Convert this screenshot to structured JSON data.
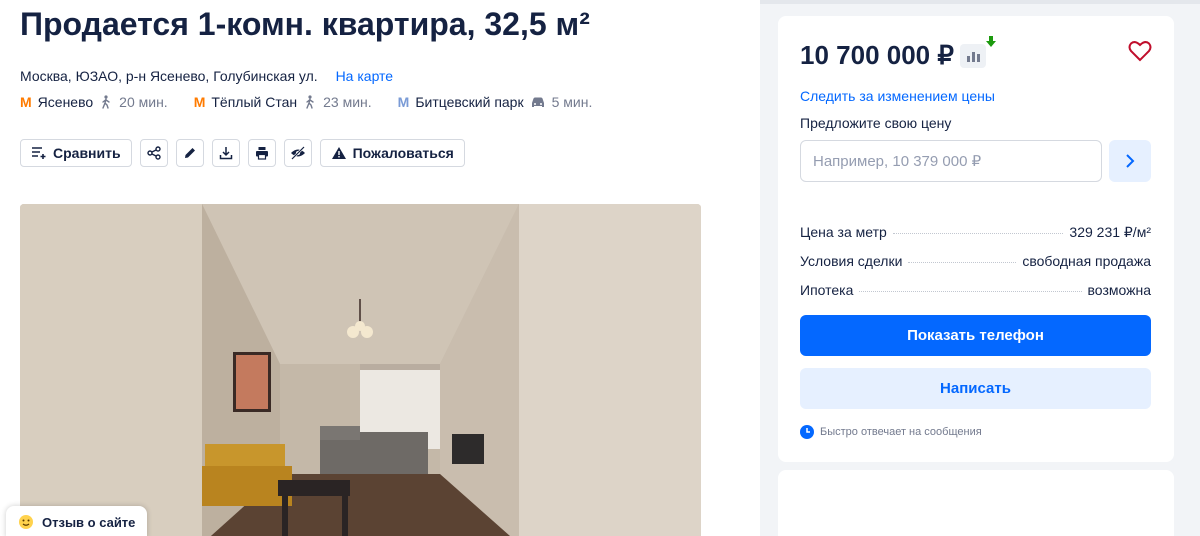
{
  "listing": {
    "title": "Продается 1-комн. квартира, 32,5 м²",
    "address": "Москва, ЮЗАО, р-н Ясенево, Голубинская ул.",
    "map_link": "На карте"
  },
  "metro": [
    {
      "station": "Ясенево",
      "time": "20 мин.",
      "mode": "walk",
      "line_color": "#ff7b00"
    },
    {
      "station": "Тёплый Стан",
      "time": "23 мин.",
      "mode": "walk",
      "line_color": "#ff7b00"
    },
    {
      "station": "Битцевский парк",
      "time": "5 мин.",
      "mode": "car",
      "line_color": "#7a9bd6"
    }
  ],
  "toolbar": {
    "compare_label": "Сравнить",
    "report_label": "Пожаловаться"
  },
  "feedback": {
    "label": "Отзыв о сайте"
  },
  "sidebar": {
    "price": "10 700 000 ₽",
    "track_price_link": "Следить за изменением цены",
    "offer_label": "Предложите свою цену",
    "offer_placeholder": "Например, 10 379 000 ₽",
    "facts": [
      {
        "key": "Цена за метр",
        "value": "329 231 ₽/м²"
      },
      {
        "key": "Условия сделки",
        "value": "свободная продажа"
      },
      {
        "key": "Ипотека",
        "value": "возможна"
      }
    ],
    "show_phone_label": "Показать телефон",
    "write_label": "Написать",
    "reply_note": "Быстро отвечает на сообщения"
  },
  "colors": {
    "accent": "#0468ff",
    "accent_light": "#e6f0ff",
    "text": "#152242",
    "muted": "#737a8e",
    "price_drop": "#1c9a0e",
    "favorite": "#c00e2c"
  },
  "icons": {
    "toolbar": [
      "compare-icon",
      "share-icon",
      "edit-icon",
      "download-icon",
      "print-icon",
      "hide-icon",
      "warning-icon"
    ],
    "sidebar": [
      "price-chart-icon",
      "price-down-arrow-icon",
      "heart-icon",
      "chevron-right-icon",
      "clock-icon"
    ],
    "feedback": "smiley-icon"
  }
}
